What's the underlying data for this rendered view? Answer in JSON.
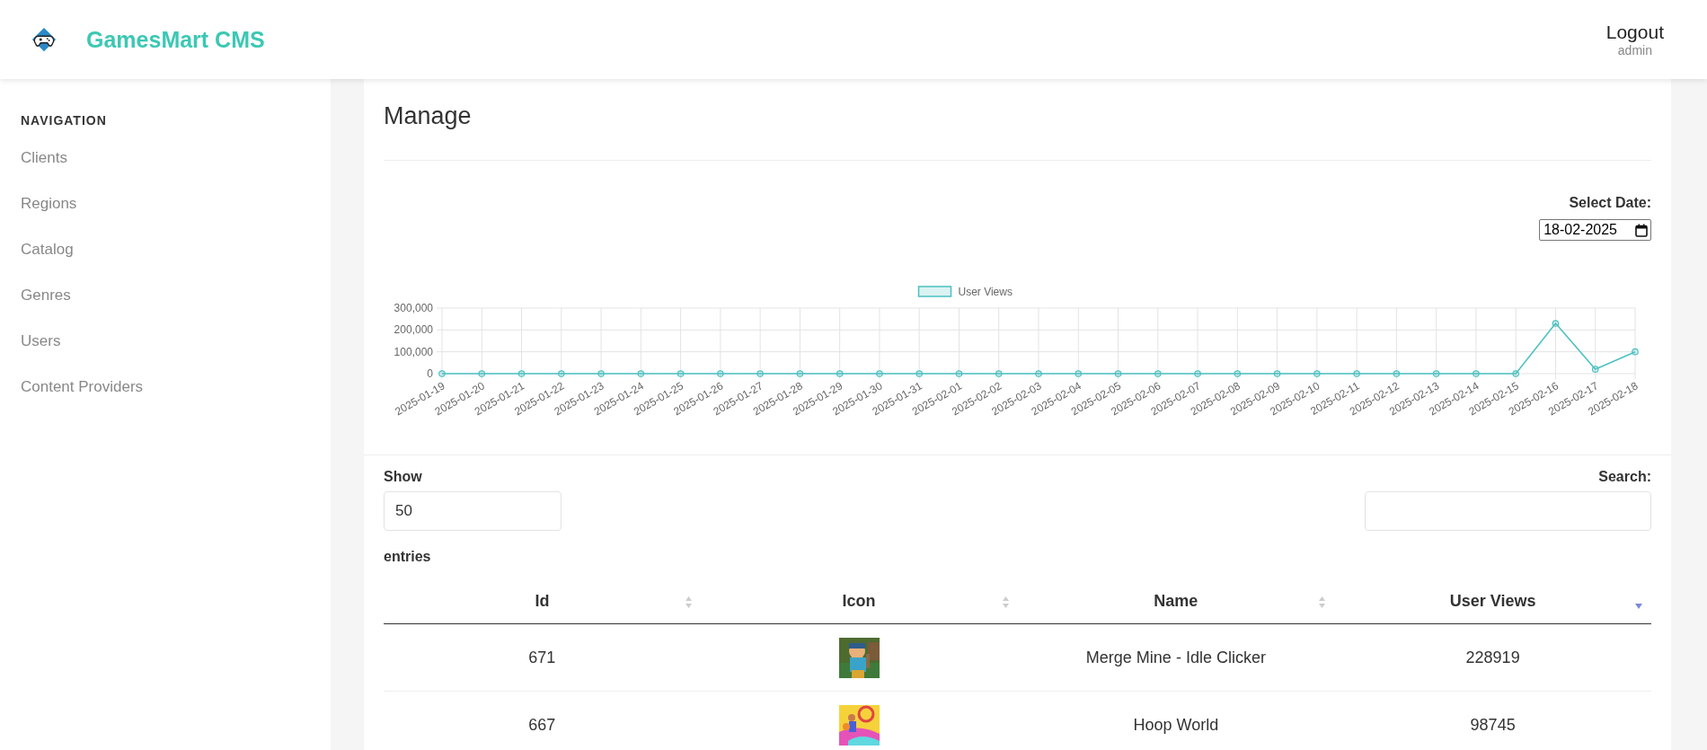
{
  "header": {
    "brand": "GamesMart CMS",
    "logout": "Logout",
    "user": "admin"
  },
  "sidebar": {
    "heading": "NAVIGATION",
    "items": [
      {
        "label": "Clients"
      },
      {
        "label": "Regions"
      },
      {
        "label": "Catalog"
      },
      {
        "label": "Genres"
      },
      {
        "label": "Users"
      },
      {
        "label": "Content Providers"
      }
    ]
  },
  "page": {
    "title": "Manage",
    "date_label": "Select Date:",
    "date_value": "18-02-2025",
    "chart_data": {
      "type": "line",
      "categories": [
        "2025-01-19",
        "2025-01-20",
        "2025-01-21",
        "2025-01-22",
        "2025-01-23",
        "2025-01-24",
        "2025-01-25",
        "2025-01-26",
        "2025-01-27",
        "2025-01-28",
        "2025-01-29",
        "2025-01-30",
        "2025-01-31",
        "2025-02-01",
        "2025-02-02",
        "2025-02-03",
        "2025-02-04",
        "2025-02-05",
        "2025-02-06",
        "2025-02-07",
        "2025-02-08",
        "2025-02-09",
        "2025-02-10",
        "2025-02-11",
        "2025-02-12",
        "2025-02-13",
        "2025-02-14",
        "2025-02-15",
        "2025-02-16",
        "2025-02-17",
        "2025-02-18"
      ],
      "grid": true,
      "series": [
        {
          "name": "User Views",
          "color": "#4bc0c0",
          "marker": "circle",
          "values": [
            0,
            0,
            0,
            0,
            0,
            0,
            0,
            0,
            0,
            0,
            0,
            0,
            0,
            0,
            0,
            0,
            0,
            0,
            0,
            0,
            0,
            0,
            0,
            0,
            0,
            0,
            0,
            0,
            230000,
            20000,
            100000
          ]
        }
      ],
      "ylim": [
        0,
        300000
      ],
      "yticks": [
        {
          "value": 0,
          "label": "0"
        },
        {
          "value": 100000,
          "label": "100,000"
        },
        {
          "value": 200000,
          "label": "200,000"
        },
        {
          "value": 300000,
          "label": "300,000"
        }
      ]
    },
    "show_label": "Show",
    "show_value": "50",
    "entries_label": "entries",
    "search_label": "Search:",
    "table": {
      "columns": [
        {
          "label": "Id",
          "sorted": false
        },
        {
          "label": "Icon",
          "sorted": false
        },
        {
          "label": "Name",
          "sorted": false
        },
        {
          "label": "User Views",
          "sorted": true
        }
      ],
      "rows": [
        {
          "id": "671",
          "name": "Merge Mine - Idle Clicker",
          "views": "228919"
        },
        {
          "id": "667",
          "name": "Hoop World",
          "views": "98745"
        }
      ]
    }
  }
}
